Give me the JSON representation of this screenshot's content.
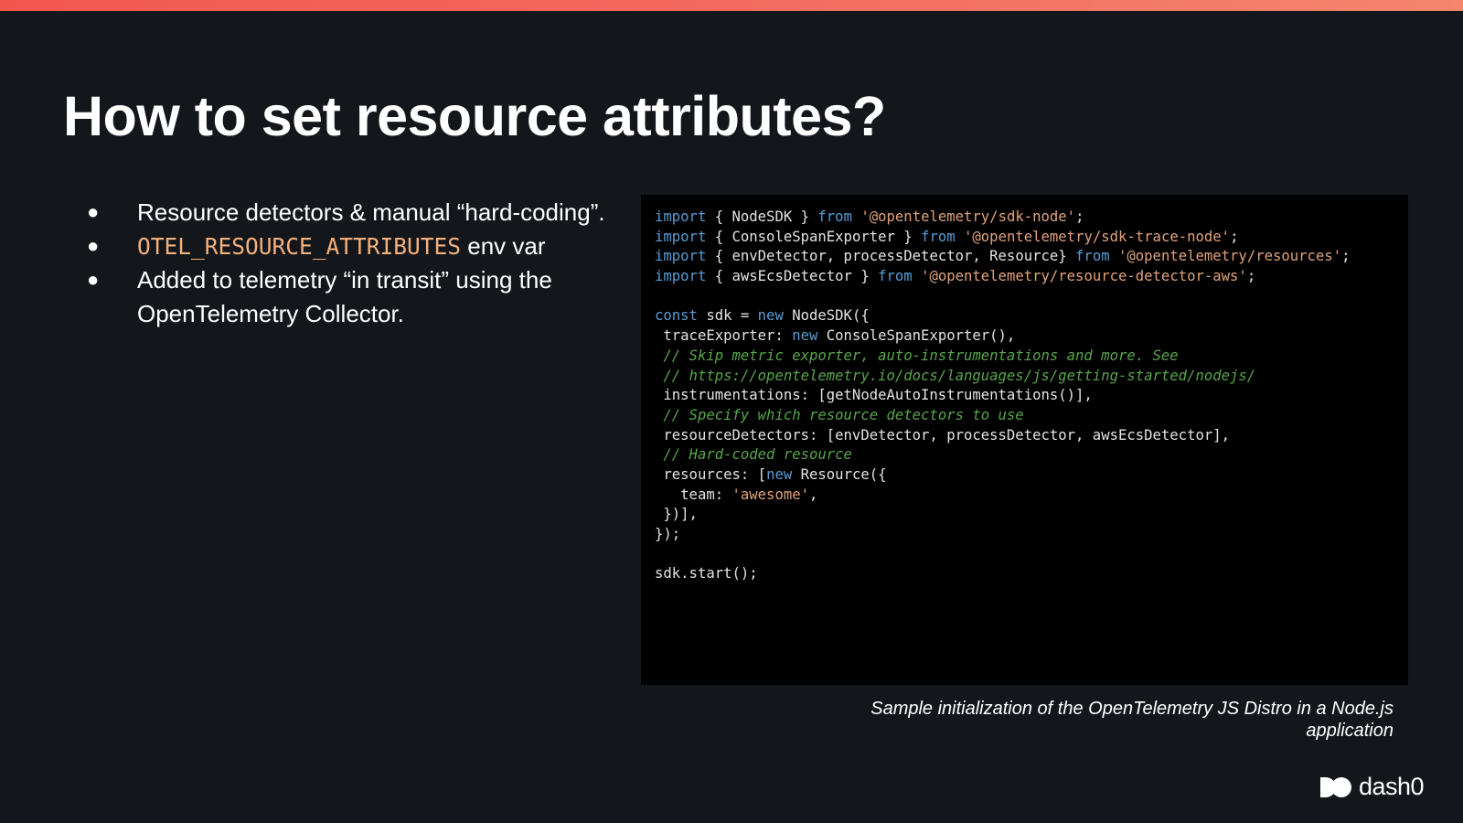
{
  "slide": {
    "title": "How to set resource attributes?",
    "bullets": [
      {
        "segments": [
          {
            "text": "Resource detectors & manual “hard-coding”.",
            "style": "plain"
          }
        ]
      },
      {
        "segments": [
          {
            "text": "OTEL_RESOURCE_ATTRIBUTES",
            "style": "code"
          },
          {
            "text": " env var",
            "style": "plain"
          }
        ]
      },
      {
        "segments": [
          {
            "text": "Added to telemetry “in transit” using the OpenTelemetry Collector.",
            "style": "plain"
          }
        ]
      }
    ],
    "bullet_symbol": "●",
    "caption": "Sample initialization of the OpenTelemetry JS Distro in a Node.js application",
    "logo_text": "dash0"
  },
  "colors": {
    "background": "#13171c",
    "accent_bar": "#f46a60",
    "env_var": "#f4b17c",
    "keyword": "#569cd6",
    "string": "#e0a27a",
    "comment": "#57a64a",
    "code_bg": "#000000"
  },
  "code": {
    "language": "javascript",
    "lines": [
      [
        [
          "kw",
          "import"
        ],
        [
          "pl",
          " { NodeSDK } "
        ],
        [
          "kw",
          "from"
        ],
        [
          "pl",
          " "
        ],
        [
          "str",
          "'@opentelemetry/sdk-node'"
        ],
        [
          "pl",
          ";"
        ]
      ],
      [
        [
          "kw",
          "import"
        ],
        [
          "pl",
          " { ConsoleSpanExporter } "
        ],
        [
          "kw",
          "from"
        ],
        [
          "pl",
          " "
        ],
        [
          "str",
          "'@opentelemetry/sdk-trace-node'"
        ],
        [
          "pl",
          ";"
        ]
      ],
      [
        [
          "kw",
          "import"
        ],
        [
          "pl",
          " { envDetector, processDetector, Resource} "
        ],
        [
          "kw",
          "from"
        ],
        [
          "pl",
          " "
        ],
        [
          "str",
          "'@opentelemetry/resources'"
        ],
        [
          "pl",
          ";"
        ]
      ],
      [
        [
          "kw",
          "import"
        ],
        [
          "pl",
          " { awsEcsDetector } "
        ],
        [
          "kw",
          "from"
        ],
        [
          "pl",
          " "
        ],
        [
          "str",
          "'@opentelemetry/resource-detector-aws'"
        ],
        [
          "pl",
          ";"
        ]
      ],
      [],
      [
        [
          "kw",
          "const"
        ],
        [
          "pl",
          " sdk = "
        ],
        [
          "kw",
          "new"
        ],
        [
          "pl",
          " NodeSDK({"
        ]
      ],
      [
        [
          "pl",
          " traceExporter: "
        ],
        [
          "kw",
          "new"
        ],
        [
          "pl",
          " ConsoleSpanExporter(),"
        ]
      ],
      [
        [
          "pl",
          " "
        ],
        [
          "cmt",
          "// Skip metric exporter, auto-instrumentations and more. See"
        ]
      ],
      [
        [
          "pl",
          " "
        ],
        [
          "cmt",
          "// https://opentelemetry.io/docs/languages/js/getting-started/nodejs/"
        ]
      ],
      [
        [
          "pl",
          " instrumentations: [getNodeAutoInstrumentations()],"
        ]
      ],
      [
        [
          "pl",
          " "
        ],
        [
          "cmt",
          "// Specify which resource detectors to use"
        ]
      ],
      [
        [
          "pl",
          " resourceDetectors: [envDetector, processDetector, awsEcsDetector],"
        ]
      ],
      [
        [
          "pl",
          " "
        ],
        [
          "cmt",
          "// Hard-coded resource"
        ]
      ],
      [
        [
          "pl",
          " resources: ["
        ],
        [
          "kw",
          "new"
        ],
        [
          "pl",
          " Resource({"
        ]
      ],
      [
        [
          "pl",
          "   team: "
        ],
        [
          "str",
          "'awesome'"
        ],
        [
          "pl",
          ","
        ]
      ],
      [
        [
          "pl",
          " })],"
        ]
      ],
      [
        [
          "pl",
          "});"
        ]
      ],
      [],
      [
        [
          "pl",
          "sdk.start();"
        ]
      ]
    ]
  }
}
